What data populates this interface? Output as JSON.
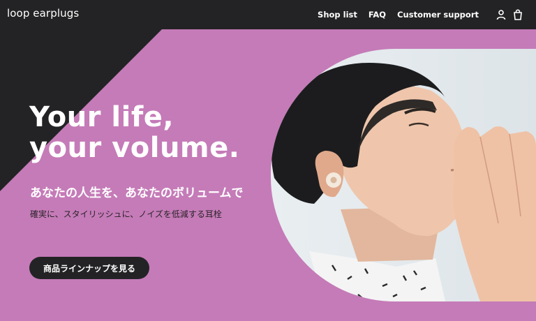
{
  "header": {
    "logo": "loop earplugs",
    "nav": [
      "Shop list",
      "FAQ",
      "Customer support"
    ],
    "icons": [
      "account-icon",
      "cart-icon"
    ]
  },
  "hero": {
    "headline_line1": "Your life,",
    "headline_line2": "your volume.",
    "subheading": "あなたの人生を、あなたのボリュームで",
    "description": "確実に、スタイリッシュに、ノイズを低減する耳栓",
    "cta_label": "商品ラインナップを見る"
  },
  "colors": {
    "header_bg": "#232325",
    "hero_bg": "#c57bb8",
    "text_light": "#ffffff",
    "button_bg": "#232325"
  }
}
